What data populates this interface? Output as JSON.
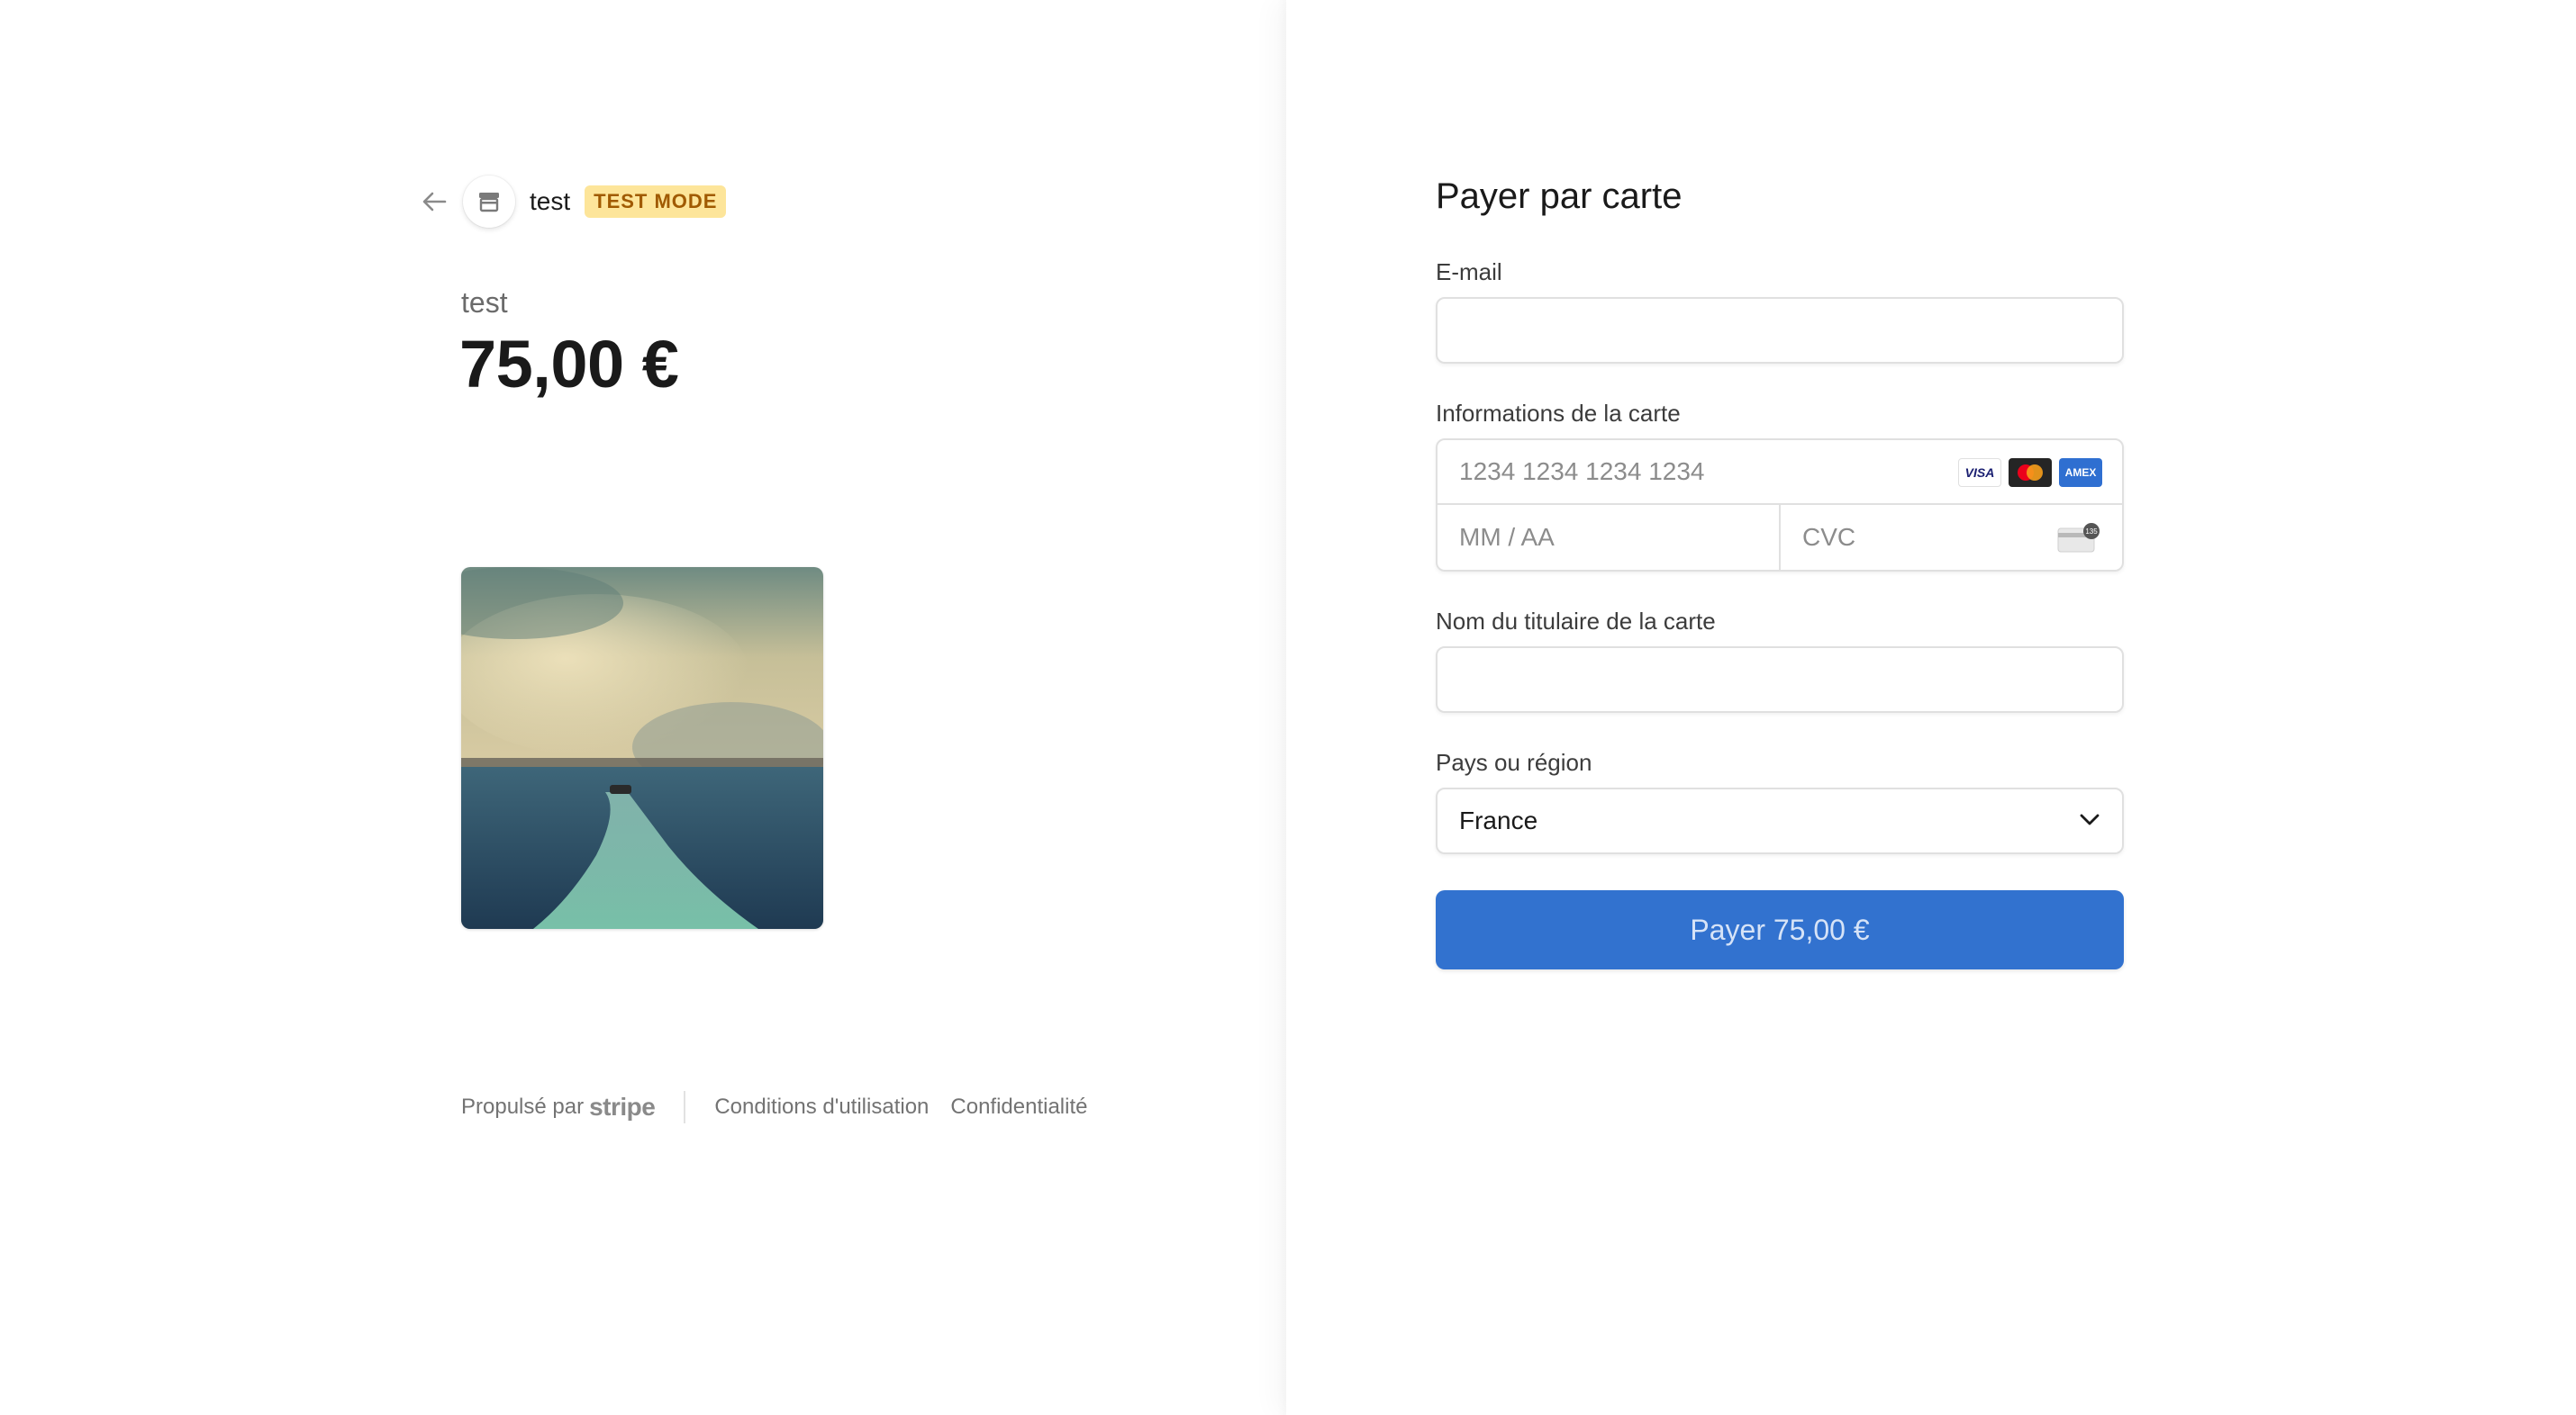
{
  "merchant": {
    "name": "test",
    "badge": "TEST MODE"
  },
  "product": {
    "name": "test",
    "price": "75,00 €"
  },
  "footer": {
    "powered_by": "Propulsé par",
    "stripe": "stripe",
    "terms": "Conditions d'utilisation",
    "privacy": "Confidentialité"
  },
  "form": {
    "title": "Payer par carte",
    "email_label": "E-mail",
    "email_value": "",
    "card_label": "Informations de la carte",
    "card_number_placeholder": "1234 1234 1234 1234",
    "expiry_placeholder": "MM / AA",
    "cvc_placeholder": "CVC",
    "card_brands": [
      "VISA",
      "mastercard",
      "AMEX"
    ],
    "name_label": "Nom du titulaire de la carte",
    "name_value": "",
    "country_label": "Pays ou région",
    "country_value": "France",
    "pay_button": "Payer 75,00 €"
  },
  "colors": {
    "accent": "#3272cf",
    "badge_bg": "#fde59a",
    "badge_text": "#a05a00"
  },
  "icons": {
    "back": "arrow-left-icon",
    "store": "store-icon",
    "select": "chevron-down-icon",
    "cvc": "cvc-card-icon"
  }
}
